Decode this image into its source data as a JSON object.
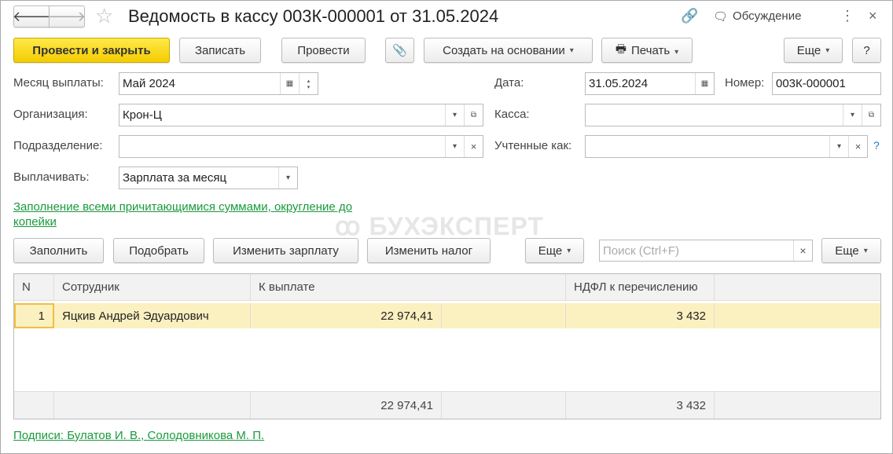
{
  "title": "Ведомость в кассу 003К-000001 от 31.05.2024",
  "header": {
    "discussion": "Обсуждение"
  },
  "toolbar": {
    "post_close": "Провести и закрыть",
    "save": "Записать",
    "post": "Провести",
    "create_based": "Создать на основании",
    "print": "Печать",
    "more": "Еще",
    "help": "?"
  },
  "form": {
    "month_label": "Месяц выплаты:",
    "month_value": "Май 2024",
    "date_label": "Дата:",
    "date_value": "31.05.2024",
    "number_label": "Номер:",
    "number_value": "003К-000001",
    "org_label": "Организация:",
    "org_value": "Крон-Ц",
    "cash_label": "Касса:",
    "cash_value": "",
    "dept_label": "Подразделение:",
    "dept_value": "",
    "accounted_label": "Учтенные как:",
    "accounted_value": "",
    "pay_label": "Выплачивать:",
    "pay_value": "Зарплата за месяц",
    "fill_link": "Заполнение всеми причитающимися суммами, округление до копейки"
  },
  "watermark": "БУХЭКСПЕРТ",
  "table_toolbar": {
    "fill": "Заполнить",
    "pick": "Подобрать",
    "change_salary": "Изменить зарплату",
    "change_tax": "Изменить налог",
    "more": "Еще",
    "search_placeholder": "Поиск (Ctrl+F)",
    "more2": "Еще"
  },
  "table": {
    "headers": [
      "N",
      "Сотрудник",
      "К выплате",
      "НДФЛ к перечислению"
    ],
    "rows": [
      {
        "n": "1",
        "employee": "Яцкив Андрей Эдуардович",
        "pay": "22 974,41",
        "ndfl": "3 432"
      }
    ],
    "totals": {
      "pay": "22 974,41",
      "ndfl": "3 432"
    }
  },
  "signatures": "Подписи: Булатов И. В., Солодовникова М. П."
}
